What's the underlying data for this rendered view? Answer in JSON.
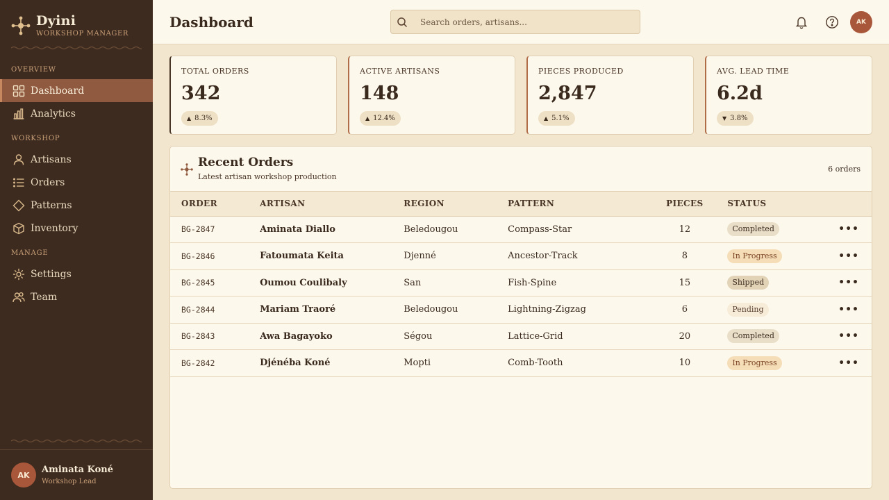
{
  "brand": {
    "name": "Dyini",
    "subtitle": "WORKSHOP MANAGER"
  },
  "sidebar": {
    "sections": [
      "OVERVIEW",
      "WORKSHOP",
      "MANAGE"
    ],
    "items": [
      {
        "label": "Dashboard",
        "icon": "grid-icon",
        "active": true
      },
      {
        "label": "Analytics",
        "icon": "bar-chart-icon"
      },
      {
        "label": "Artisans",
        "icon": "user-icon"
      },
      {
        "label": "Orders",
        "icon": "list-icon"
      },
      {
        "label": "Patterns",
        "icon": "diamond-icon"
      },
      {
        "label": "Inventory",
        "icon": "box-icon"
      },
      {
        "label": "Settings",
        "icon": "gear-icon"
      },
      {
        "label": "Team",
        "icon": "users-icon"
      }
    ]
  },
  "user": {
    "initials": "AK",
    "name": "Aminata Koné",
    "role": "Workshop Lead"
  },
  "header": {
    "title": "Dashboard",
    "search_placeholder": "Search orders, artisans...",
    "avatar_initials": "AK"
  },
  "stats": [
    {
      "label": "TOTAL ORDERS",
      "value": "342",
      "delta": "8.3%",
      "trend": "up"
    },
    {
      "label": "ACTIVE ARTISANS",
      "value": "148",
      "delta": "12.4%",
      "trend": "up"
    },
    {
      "label": "PIECES PRODUCED",
      "value": "2,847",
      "delta": "5.1%",
      "trend": "up"
    },
    {
      "label": "AVG. LEAD TIME",
      "value": "6.2d",
      "delta": "3.8%",
      "trend": "down"
    }
  ],
  "orders_panel": {
    "title": "Recent Orders",
    "subtitle": "Latest artisan workshop production",
    "count": "6 orders",
    "columns": [
      "ORDER",
      "ARTISAN",
      "REGION",
      "PATTERN",
      "PIECES",
      "STATUS"
    ],
    "rows": [
      {
        "order": "BG-2847",
        "artisan": "Aminata Diallo",
        "region": "Beledougou",
        "pattern": "Compass-Star",
        "pieces": "12",
        "status": "Completed"
      },
      {
        "order": "BG-2846",
        "artisan": "Fatoumata Keita",
        "region": "Djenné",
        "pattern": "Ancestor-Track",
        "pieces": "8",
        "status": "In Progress"
      },
      {
        "order": "BG-2845",
        "artisan": "Oumou Coulibaly",
        "region": "San",
        "pattern": "Fish-Spine",
        "pieces": "15",
        "status": "Shipped"
      },
      {
        "order": "BG-2844",
        "artisan": "Mariam Traoré",
        "region": "Beledougou",
        "pattern": "Lightning-Zigzag",
        "pieces": "6",
        "status": "Pending"
      },
      {
        "order": "BG-2843",
        "artisan": "Awa Bagayoko",
        "region": "Ségou",
        "pattern": "Lattice-Grid",
        "pieces": "20",
        "status": "Completed"
      },
      {
        "order": "BG-2842",
        "artisan": "Djénéba Koné",
        "region": "Mopti",
        "pattern": "Comb-Tooth",
        "pieces": "10",
        "status": "In Progress"
      }
    ]
  },
  "colors": {
    "sidebar_bg": "#3e2b1f",
    "active_nav": "#8f5a3f",
    "accent": "#b06b47",
    "page_bg": "#f2e6cf",
    "card_bg": "#fdf8ec"
  }
}
